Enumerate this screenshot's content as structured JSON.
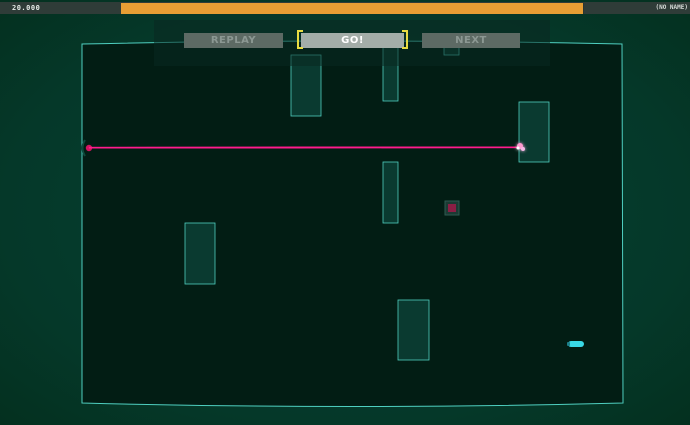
{
  "hud": {
    "score": "20.000",
    "progress": 0.998,
    "player_name": "(NO NAME)"
  },
  "buttons": {
    "replay": "REPLAY",
    "go": "GO!",
    "next": "NEXT"
  },
  "colors": {
    "background": "#063a2c",
    "arena_fill": "#021d14",
    "outline": "#4fcfc0",
    "laser": "#ff1a8c",
    "progress": "#e79e34",
    "selected_bracket": "#e8dc42",
    "target": "#8a1e44",
    "player_pod": "#39d9e6"
  }
}
